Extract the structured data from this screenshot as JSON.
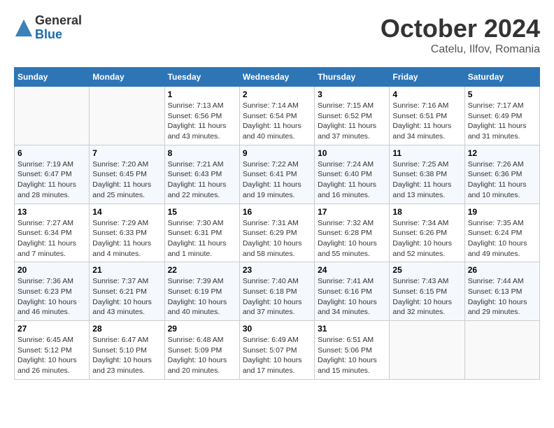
{
  "header": {
    "logo_general": "General",
    "logo_blue": "Blue",
    "month": "October 2024",
    "location": "Catelu, Ilfov, Romania"
  },
  "days_of_week": [
    "Sunday",
    "Monday",
    "Tuesday",
    "Wednesday",
    "Thursday",
    "Friday",
    "Saturday"
  ],
  "weeks": [
    [
      {
        "num": "",
        "sunrise": "",
        "sunset": "",
        "daylight": ""
      },
      {
        "num": "",
        "sunrise": "",
        "sunset": "",
        "daylight": ""
      },
      {
        "num": "1",
        "sunrise": "Sunrise: 7:13 AM",
        "sunset": "Sunset: 6:56 PM",
        "daylight": "Daylight: 11 hours and 43 minutes."
      },
      {
        "num": "2",
        "sunrise": "Sunrise: 7:14 AM",
        "sunset": "Sunset: 6:54 PM",
        "daylight": "Daylight: 11 hours and 40 minutes."
      },
      {
        "num": "3",
        "sunrise": "Sunrise: 7:15 AM",
        "sunset": "Sunset: 6:52 PM",
        "daylight": "Daylight: 11 hours and 37 minutes."
      },
      {
        "num": "4",
        "sunrise": "Sunrise: 7:16 AM",
        "sunset": "Sunset: 6:51 PM",
        "daylight": "Daylight: 11 hours and 34 minutes."
      },
      {
        "num": "5",
        "sunrise": "Sunrise: 7:17 AM",
        "sunset": "Sunset: 6:49 PM",
        "daylight": "Daylight: 11 hours and 31 minutes."
      }
    ],
    [
      {
        "num": "6",
        "sunrise": "Sunrise: 7:19 AM",
        "sunset": "Sunset: 6:47 PM",
        "daylight": "Daylight: 11 hours and 28 minutes."
      },
      {
        "num": "7",
        "sunrise": "Sunrise: 7:20 AM",
        "sunset": "Sunset: 6:45 PM",
        "daylight": "Daylight: 11 hours and 25 minutes."
      },
      {
        "num": "8",
        "sunrise": "Sunrise: 7:21 AM",
        "sunset": "Sunset: 6:43 PM",
        "daylight": "Daylight: 11 hours and 22 minutes."
      },
      {
        "num": "9",
        "sunrise": "Sunrise: 7:22 AM",
        "sunset": "Sunset: 6:41 PM",
        "daylight": "Daylight: 11 hours and 19 minutes."
      },
      {
        "num": "10",
        "sunrise": "Sunrise: 7:24 AM",
        "sunset": "Sunset: 6:40 PM",
        "daylight": "Daylight: 11 hours and 16 minutes."
      },
      {
        "num": "11",
        "sunrise": "Sunrise: 7:25 AM",
        "sunset": "Sunset: 6:38 PM",
        "daylight": "Daylight: 11 hours and 13 minutes."
      },
      {
        "num": "12",
        "sunrise": "Sunrise: 7:26 AM",
        "sunset": "Sunset: 6:36 PM",
        "daylight": "Daylight: 11 hours and 10 minutes."
      }
    ],
    [
      {
        "num": "13",
        "sunrise": "Sunrise: 7:27 AM",
        "sunset": "Sunset: 6:34 PM",
        "daylight": "Daylight: 11 hours and 7 minutes."
      },
      {
        "num": "14",
        "sunrise": "Sunrise: 7:29 AM",
        "sunset": "Sunset: 6:33 PM",
        "daylight": "Daylight: 11 hours and 4 minutes."
      },
      {
        "num": "15",
        "sunrise": "Sunrise: 7:30 AM",
        "sunset": "Sunset: 6:31 PM",
        "daylight": "Daylight: 11 hours and 1 minute."
      },
      {
        "num": "16",
        "sunrise": "Sunrise: 7:31 AM",
        "sunset": "Sunset: 6:29 PM",
        "daylight": "Daylight: 10 hours and 58 minutes."
      },
      {
        "num": "17",
        "sunrise": "Sunrise: 7:32 AM",
        "sunset": "Sunset: 6:28 PM",
        "daylight": "Daylight: 10 hours and 55 minutes."
      },
      {
        "num": "18",
        "sunrise": "Sunrise: 7:34 AM",
        "sunset": "Sunset: 6:26 PM",
        "daylight": "Daylight: 10 hours and 52 minutes."
      },
      {
        "num": "19",
        "sunrise": "Sunrise: 7:35 AM",
        "sunset": "Sunset: 6:24 PM",
        "daylight": "Daylight: 10 hours and 49 minutes."
      }
    ],
    [
      {
        "num": "20",
        "sunrise": "Sunrise: 7:36 AM",
        "sunset": "Sunset: 6:23 PM",
        "daylight": "Daylight: 10 hours and 46 minutes."
      },
      {
        "num": "21",
        "sunrise": "Sunrise: 7:37 AM",
        "sunset": "Sunset: 6:21 PM",
        "daylight": "Daylight: 10 hours and 43 minutes."
      },
      {
        "num": "22",
        "sunrise": "Sunrise: 7:39 AM",
        "sunset": "Sunset: 6:19 PM",
        "daylight": "Daylight: 10 hours and 40 minutes."
      },
      {
        "num": "23",
        "sunrise": "Sunrise: 7:40 AM",
        "sunset": "Sunset: 6:18 PM",
        "daylight": "Daylight: 10 hours and 37 minutes."
      },
      {
        "num": "24",
        "sunrise": "Sunrise: 7:41 AM",
        "sunset": "Sunset: 6:16 PM",
        "daylight": "Daylight: 10 hours and 34 minutes."
      },
      {
        "num": "25",
        "sunrise": "Sunrise: 7:43 AM",
        "sunset": "Sunset: 6:15 PM",
        "daylight": "Daylight: 10 hours and 32 minutes."
      },
      {
        "num": "26",
        "sunrise": "Sunrise: 7:44 AM",
        "sunset": "Sunset: 6:13 PM",
        "daylight": "Daylight: 10 hours and 29 minutes."
      }
    ],
    [
      {
        "num": "27",
        "sunrise": "Sunrise: 6:45 AM",
        "sunset": "Sunset: 5:12 PM",
        "daylight": "Daylight: 10 hours and 26 minutes."
      },
      {
        "num": "28",
        "sunrise": "Sunrise: 6:47 AM",
        "sunset": "Sunset: 5:10 PM",
        "daylight": "Daylight: 10 hours and 23 minutes."
      },
      {
        "num": "29",
        "sunrise": "Sunrise: 6:48 AM",
        "sunset": "Sunset: 5:09 PM",
        "daylight": "Daylight: 10 hours and 20 minutes."
      },
      {
        "num": "30",
        "sunrise": "Sunrise: 6:49 AM",
        "sunset": "Sunset: 5:07 PM",
        "daylight": "Daylight: 10 hours and 17 minutes."
      },
      {
        "num": "31",
        "sunrise": "Sunrise: 6:51 AM",
        "sunset": "Sunset: 5:06 PM",
        "daylight": "Daylight: 10 hours and 15 minutes."
      },
      {
        "num": "",
        "sunrise": "",
        "sunset": "",
        "daylight": ""
      },
      {
        "num": "",
        "sunrise": "",
        "sunset": "",
        "daylight": ""
      }
    ]
  ]
}
